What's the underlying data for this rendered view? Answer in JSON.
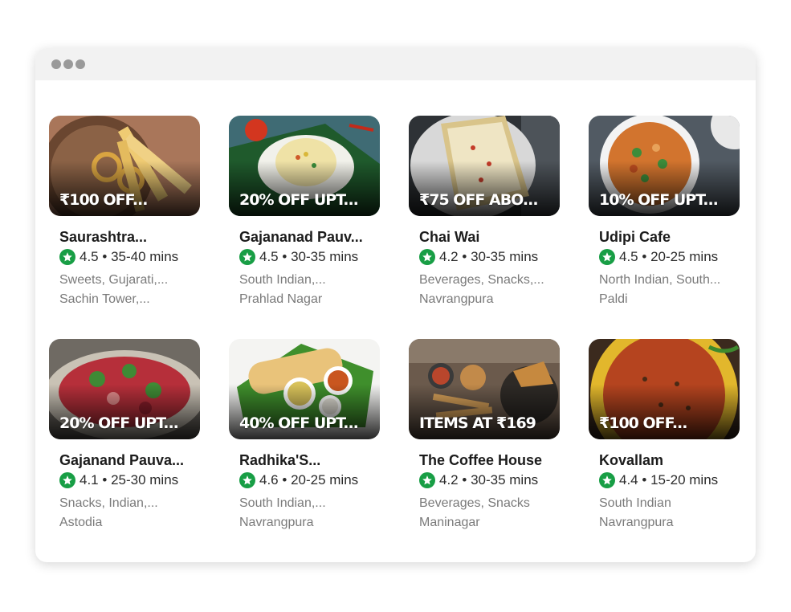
{
  "window": {
    "dots": 3
  },
  "restaurants": [
    {
      "name": "Saurashtra...",
      "offer": "₹100 OFF...",
      "rating": "4.5",
      "sep": "•",
      "time": "35-40 mins",
      "cuisine": "Sweets, Gujarati,...",
      "area": "Sachin Tower,..."
    },
    {
      "name": "Gajananad Pauv...",
      "offer": "20% OFF UPT...",
      "rating": "4.5",
      "sep": "•",
      "time": "30-35 mins",
      "cuisine": "South Indian,...",
      "area": "Prahlad Nagar"
    },
    {
      "name": "Chai Wai",
      "offer": "₹75 OFF ABO...",
      "rating": "4.2",
      "sep": "•",
      "time": "30-35 mins",
      "cuisine": "Beverages, Snacks,...",
      "area": "Navrangpura"
    },
    {
      "name": "Udipi Cafe",
      "offer": "10% OFF UPT...",
      "rating": "4.5",
      "sep": "•",
      "time": "20-25 mins",
      "cuisine": "North Indian, South...",
      "area": "Paldi"
    },
    {
      "name": "Gajanand Pauva...",
      "offer": "20% OFF UPT...",
      "rating": "4.1",
      "sep": "•",
      "time": "25-30 mins",
      "cuisine": "Snacks, Indian,...",
      "area": "Astodia"
    },
    {
      "name": "Radhika'S...",
      "offer": "40% OFF UPT...",
      "rating": "4.6",
      "sep": "•",
      "time": "20-25 mins",
      "cuisine": "South Indian,...",
      "area": "Navrangpura"
    },
    {
      "name": "The Coffee House",
      "offer": "ITEMS AT ₹169",
      "rating": "4.2",
      "sep": "•",
      "time": "30-35 mins",
      "cuisine": "Beverages, Snacks",
      "area": "Maninagar"
    },
    {
      "name": "Kovallam",
      "offer": "₹100 OFF...",
      "rating": "4.4",
      "sep": "•",
      "time": "15-20 mins",
      "cuisine": "South Indian",
      "area": "Navrangpura"
    }
  ],
  "colors": {
    "rating_badge": "#189e45",
    "name_text": "#1c1c1c",
    "meta_text": "#7a7a7a"
  },
  "icons": {
    "rating": "star-icon"
  }
}
